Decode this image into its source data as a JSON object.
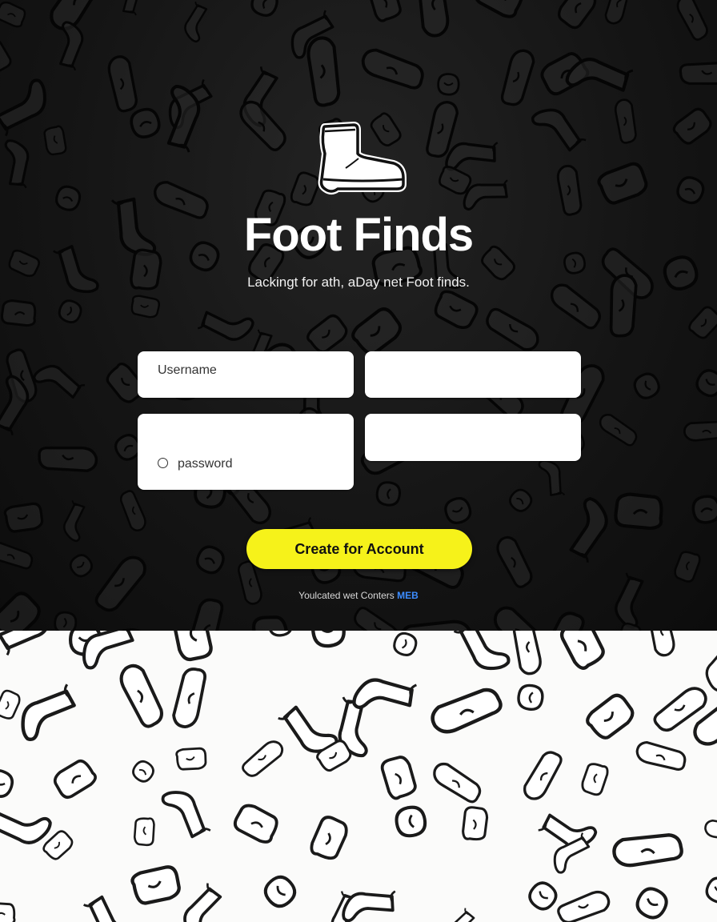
{
  "brand": {
    "title": "Foot Finds",
    "tagline": "Lackingt for ath, aDay net Foot finds."
  },
  "form": {
    "username_placeholder": "Username",
    "password_placeholder": "password",
    "field_right_top_placeholder": "",
    "field_right_bottom_placeholder": ""
  },
  "cta": {
    "label": "Create for Account"
  },
  "footer": {
    "text": "Youlcated wet Conters",
    "link": "MEB"
  },
  "colors": {
    "accent_yellow": "#f6f21a",
    "link_blue": "#3c8cff",
    "dark_bg": "#151515",
    "light_bg": "#fbfbfa"
  },
  "icons": {
    "logo": "boot-icon"
  }
}
